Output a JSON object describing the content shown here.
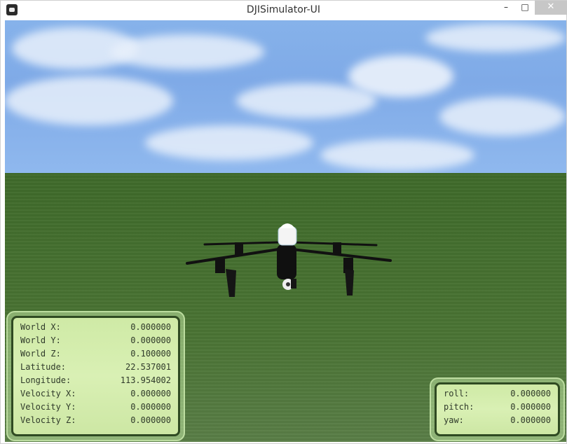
{
  "window": {
    "title": "DJISimulator-UI",
    "controls": {
      "minimize": "–",
      "maximize": "□",
      "close": "✕"
    }
  },
  "telemetry_left": [
    {
      "label": "World X:",
      "value": "0.000000"
    },
    {
      "label": "World Y:",
      "value": "0.000000"
    },
    {
      "label": "World Z:",
      "value": "0.100000"
    },
    {
      "label": "Latitude:",
      "value": "22.537001"
    },
    {
      "label": "Longitude:",
      "value": "113.954002"
    },
    {
      "label": "Velocity X:",
      "value": "0.000000"
    },
    {
      "label": "Velocity Y:",
      "value": "0.000000"
    },
    {
      "label": "Velocity Z:",
      "value": "0.000000"
    }
  ],
  "telemetry_right": [
    {
      "label": "roll:",
      "value": "0.000000"
    },
    {
      "label": "pitch:",
      "value": "0.000000"
    },
    {
      "label": "yaw:",
      "value": "0.000000"
    }
  ],
  "icons": {
    "app": "drone-app-icon",
    "drone": "drone-model"
  },
  "colors": {
    "sky": "#7faae7",
    "ground": "#4a7434",
    "hud_bg": "#d9f0b4",
    "hud_border": "#2f4a22"
  }
}
